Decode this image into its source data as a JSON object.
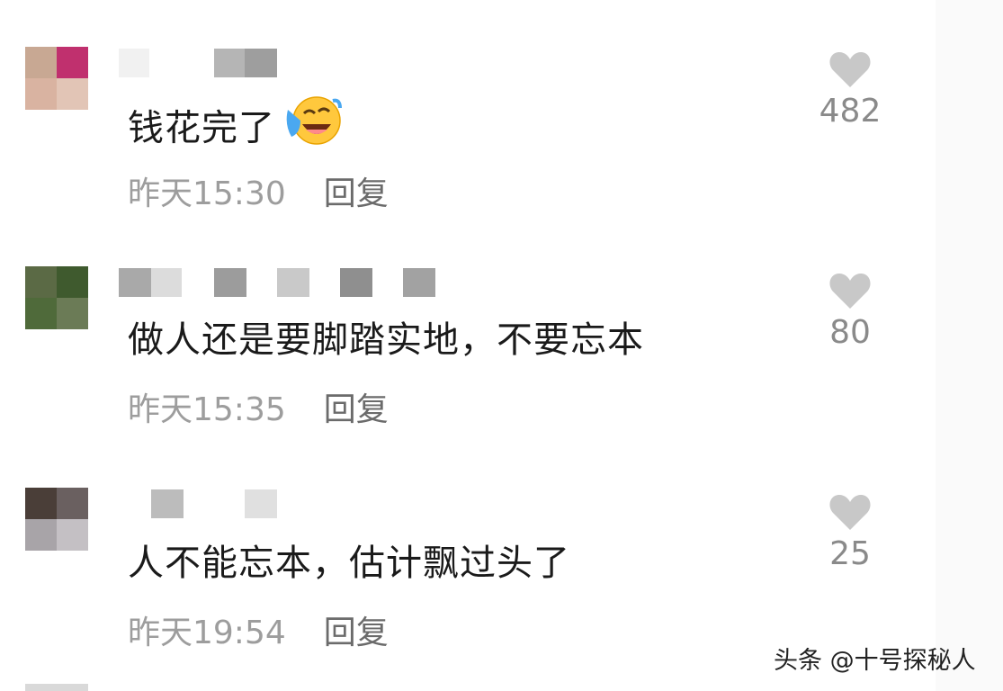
{
  "comments": [
    {
      "text": "钱花完了",
      "emoji": "laughing-crying-emoji",
      "time": "昨天15:30",
      "reply_label": "回复",
      "likes": "482"
    },
    {
      "text": "做人还是要脚踏实地，不要忘本",
      "time": "昨天15:35",
      "reply_label": "回复",
      "likes": "80"
    },
    {
      "text": "人不能忘本，估计飘过头了",
      "time": "昨天19:54",
      "reply_label": "回复",
      "likes": "25"
    }
  ],
  "icons": {
    "like": "heart-icon"
  },
  "watermark": "头条 @十号探秘人",
  "colors": {
    "text": "#1a1a1a",
    "meta": "#9d9d9d",
    "reply": "#6b6b6b",
    "heart": "#c8c8c8",
    "count": "#8a8a8a"
  }
}
